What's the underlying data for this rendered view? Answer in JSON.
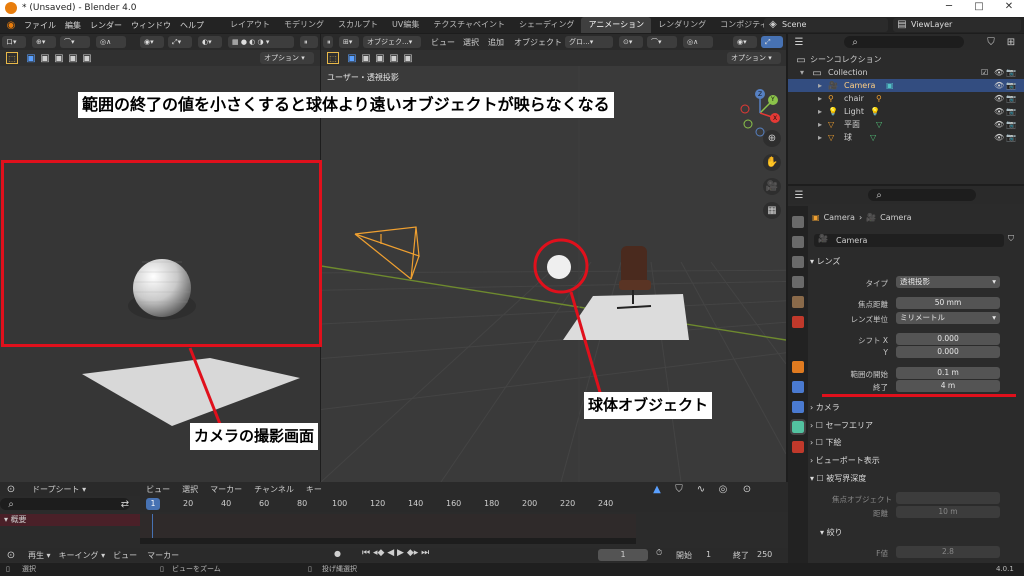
{
  "titlebar": {
    "title": "* (Unsaved) - Blender 4.0",
    "minimize": "─",
    "maximize": "□",
    "close": "✕"
  },
  "menubar": {
    "menus": [
      "ファイル",
      "編集",
      "レンダー",
      "ウィンドウ",
      "ヘルプ"
    ],
    "workspaces": [
      "レイアウト",
      "モデリング",
      "スカルプト",
      "UV編集",
      "テクスチャペイント",
      "シェーディング",
      "アニメーション",
      "レンダリング",
      "コンポジティング"
    ],
    "active_workspace": "アニメーション",
    "scene": "Scene",
    "view_layer": "ViewLayer"
  },
  "camera_panel": {
    "option_label": "オプション"
  },
  "viewport": {
    "header_menus": [
      "オブジェク...",
      "ビュー",
      "選択",
      "追加",
      "オブジェクト"
    ],
    "transform_mode": "グロ...",
    "option_label": "オプション",
    "view_name": "ユーザー・透視投影",
    "gizmo_axes": [
      "X",
      "Y",
      "Z"
    ]
  },
  "outliner": {
    "root": "シーンコレクション",
    "collection": "Collection",
    "items": [
      {
        "name": "Camera",
        "selected": true
      },
      {
        "name": "chair",
        "selected": false
      },
      {
        "name": "Light",
        "selected": false
      },
      {
        "name": "平面",
        "selected": false
      },
      {
        "name": "球",
        "selected": false
      }
    ]
  },
  "properties": {
    "breadcrumb": [
      "Camera",
      "Camera"
    ],
    "data_name": "Camera",
    "sections": {
      "lens": "レンズ",
      "camera": "カメラ",
      "safe_area": "セーフエリア",
      "background": "下絵",
      "viewport_display": "ビューポート表示",
      "dof": "被写界深度",
      "aperture": "絞り"
    },
    "fields": {
      "type_label": "タイプ",
      "type_value": "透視投影",
      "focal_label": "焦点距離",
      "focal_value": "50 mm",
      "lens_unit_label": "レンズ単位",
      "lens_unit_value": "ミリメートル",
      "shift_x_label": "シフト X",
      "shift_x_value": "0.000",
      "shift_y_label": "Y",
      "shift_y_value": "0.000",
      "clip_start_label": "範囲の開始",
      "clip_start_value": "0.1 m",
      "clip_end_label": "終了",
      "clip_end_value": "4 m",
      "focus_obj_label": "焦点オブジェクト",
      "distance_label": "距離",
      "distance_value": "10 m",
      "fstop_label": "F値",
      "fstop_value": "2.8"
    }
  },
  "timeline": {
    "mode": "ドープシート",
    "menus": [
      "ビュー",
      "選択",
      "マーカー",
      "チャンネル",
      "キー"
    ],
    "current_frame": "1",
    "ticks": [
      "20",
      "40",
      "60",
      "80",
      "100",
      "120",
      "140",
      "160",
      "180",
      "200",
      "220",
      "240"
    ],
    "summary": "概要",
    "playback_menus": [
      "再生",
      "キーイング",
      "ビュー",
      "マーカー"
    ],
    "frame_field": "1",
    "start_label": "開始",
    "start_value": "1",
    "end_label": "終了",
    "end_value": "250"
  },
  "statusbar": {
    "select": "選択",
    "zoom": "ビューをズーム",
    "lasso": "投げ縄選択",
    "version": "4.0.1"
  },
  "annotations": {
    "top": "範囲の終了の値を小さくすると球体より遠いオブジェクトが映らなくなる",
    "camera_view": "カメラの撮影画面",
    "sphere": "球体オブジェクト",
    "color": "#e0101c"
  }
}
